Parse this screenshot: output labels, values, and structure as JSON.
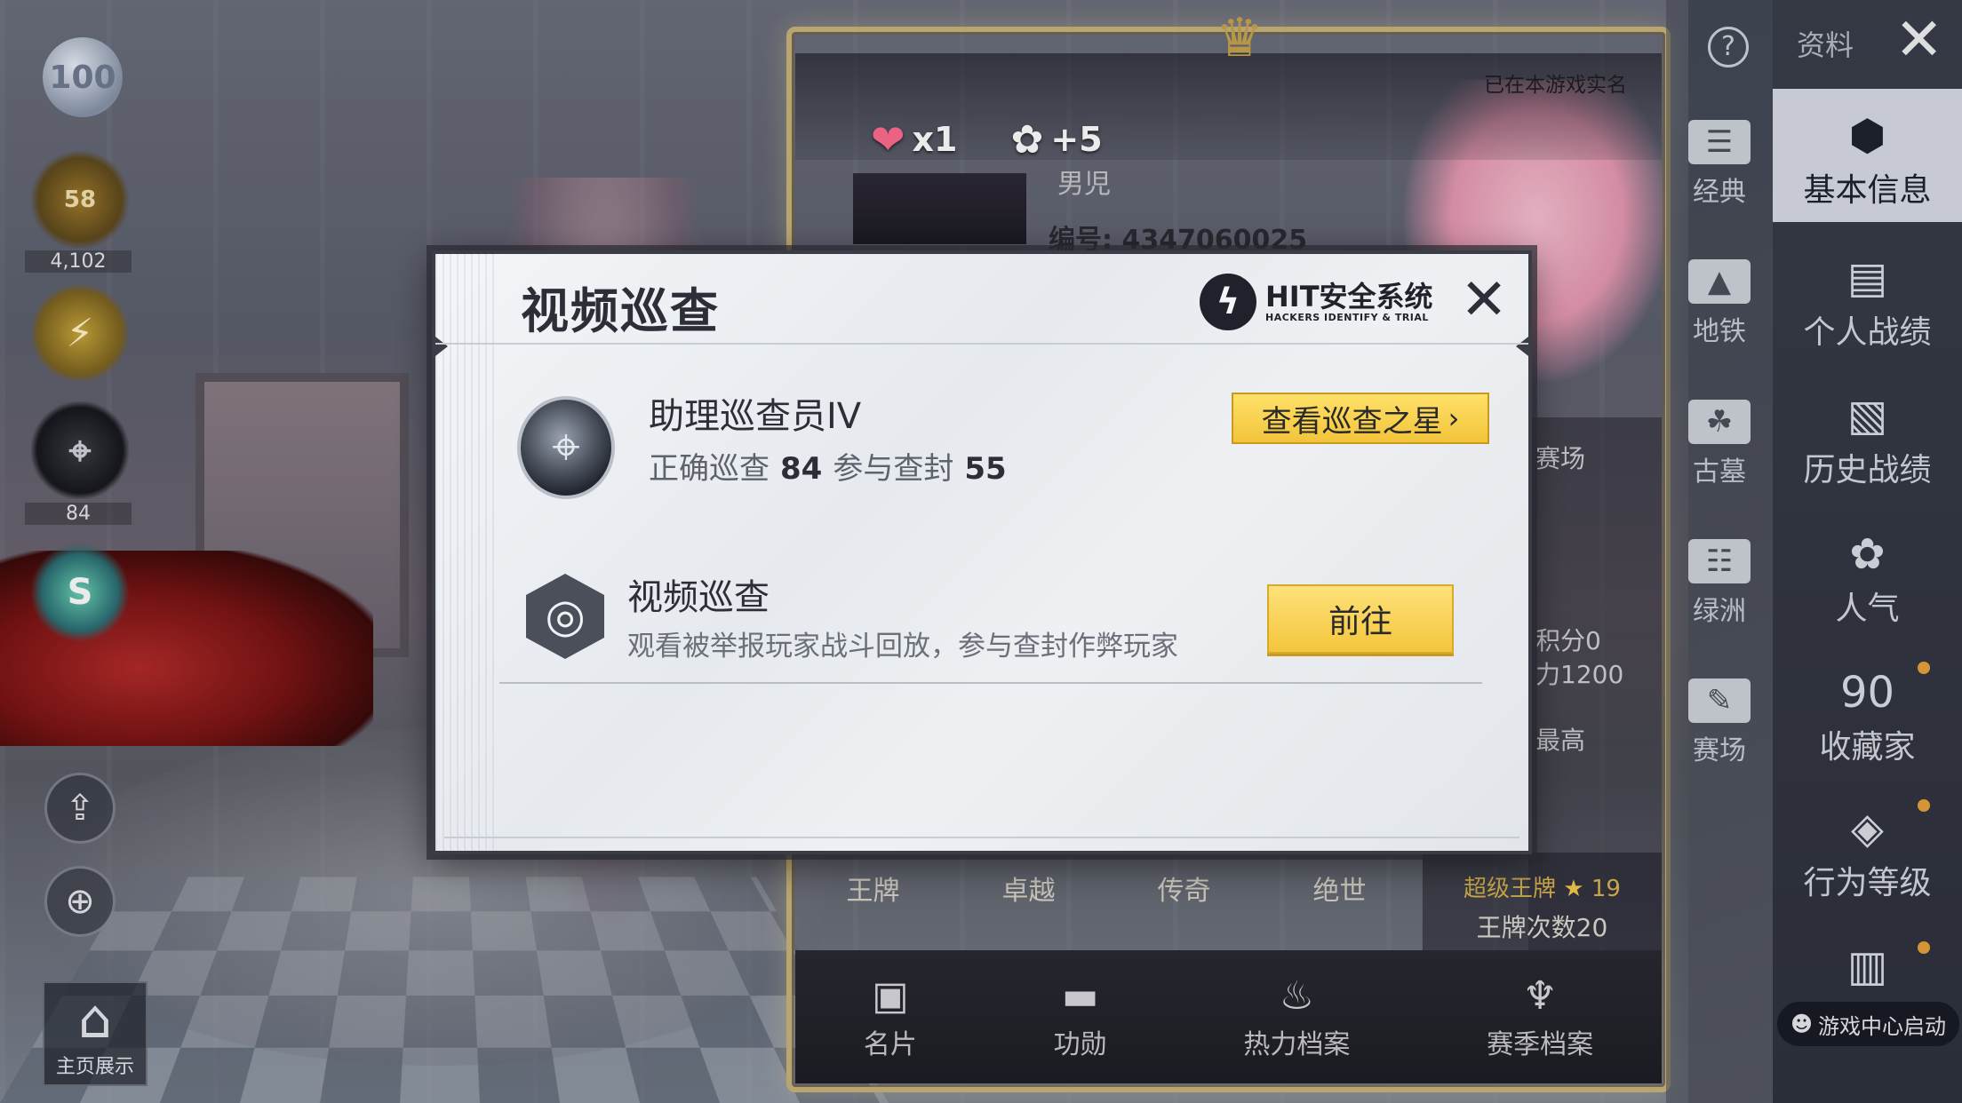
{
  "background": {
    "level_badge": "100",
    "left_emblems": [
      {
        "icon": "flame-emblem",
        "value": "58",
        "caption": "4,102"
      },
      {
        "icon": "lightning-emblem",
        "value": "",
        "caption": ""
      },
      {
        "icon": "scope-emblem",
        "value": "",
        "caption": "84"
      },
      {
        "icon": "s-emblem",
        "value": "S",
        "caption": ""
      }
    ],
    "home_label": "主页展示",
    "share_icon": "share-icon",
    "zoom_icon": "zoom-in-icon",
    "real_name_text": "已在本游戏实名",
    "gifts": [
      {
        "icon": "heart-icon",
        "text": "x1"
      },
      {
        "icon": "popularity-icon",
        "text": "+5"
      }
    ],
    "gender_text": "男児",
    "id_text": "编号: 4347060025",
    "side_texts": [
      "赛场",
      "积分0",
      "力1200",
      "最高"
    ],
    "rank_tiers": [
      "王牌",
      "卓越",
      "传奇",
      "绝世"
    ],
    "ace": {
      "label": "超级王牌",
      "stars": "19",
      "count_text": "王牌次数20"
    },
    "card_tabs": [
      {
        "label": "名片",
        "icon": "card-icon"
      },
      {
        "label": "功勋",
        "icon": "medal-icon"
      },
      {
        "label": "热力档案",
        "icon": "fire-icon"
      },
      {
        "label": "赛季档案",
        "icon": "season-icon"
      }
    ],
    "title_bar": {
      "ziliao": "资料"
    },
    "mid_nav": [
      {
        "label": "经典",
        "icon": "classic-icon"
      },
      {
        "label": "地铁",
        "icon": "metro-icon"
      },
      {
        "label": "古墓",
        "icon": "tomb-icon"
      },
      {
        "label": "绿洲",
        "icon": "oasis-icon"
      },
      {
        "label": "赛场",
        "icon": "arena-icon"
      }
    ],
    "right_nav": [
      {
        "label": "基本信息",
        "icon": "profile-icon",
        "active": true
      },
      {
        "label": "个人战绩",
        "icon": "stats-icon"
      },
      {
        "label": "历史战绩",
        "icon": "history-icon"
      },
      {
        "label": "人气",
        "icon": "popularity-icon"
      },
      {
        "label": "收藏家",
        "icon": "collector-icon",
        "badge": "90"
      },
      {
        "label": "行为等级",
        "icon": "behavior-icon"
      }
    ],
    "game_center": "游戏中心启动"
  },
  "dialog": {
    "title": "视频巡查",
    "logo": {
      "main": "HIT安全系统",
      "sub": "HACKERS IDENTIFY & TRIAL"
    },
    "rank": {
      "name": "助理巡查员IV",
      "correct_label": "正确巡查",
      "correct_value": "84",
      "ban_label": "参与查封",
      "ban_value": "55"
    },
    "star_button": "查看巡查之星",
    "task": {
      "title": "视频巡查",
      "description": "观看被举报玩家战斗回放，参与查封作弊玩家",
      "button": "前往"
    }
  },
  "colors": {
    "accent_yellow": "#f3c53c",
    "dialog_bg": "#eceff3",
    "dialog_border": "#3a3d45"
  }
}
